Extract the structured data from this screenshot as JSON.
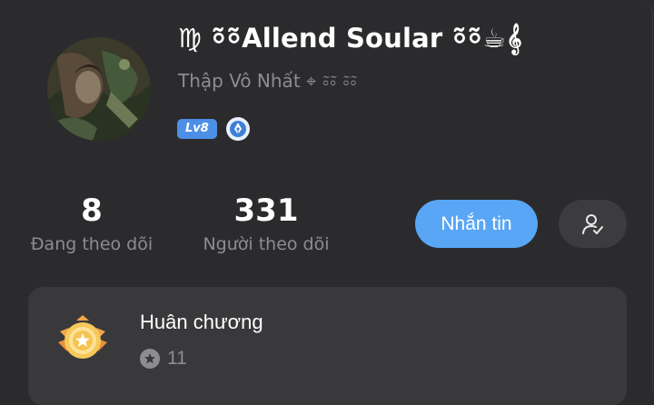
{
  "profile": {
    "display_name": "♍ ⸰̃⸰̃Allend Soular ⸰̃⸰̃☕𝄞",
    "subtitle": "Thập Vô Nhất ⌖ ⸰̃⸰̃ ⸰̃⸰̃",
    "level_badge": "Lv8",
    "emblem_icon": "pen-nib-icon",
    "accent_color": "#58a6f5"
  },
  "stats": {
    "following_count": "8",
    "following_label": "Đang theo dõi",
    "followers_count": "331",
    "followers_label": "Người theo dõi"
  },
  "actions": {
    "message_label": "Nhắn tin",
    "follow_icon": "user-check-icon"
  },
  "medals": {
    "title": "Huân chương",
    "count": "11",
    "count_icon": "star-icon",
    "medal_icon": "medal-icon"
  }
}
